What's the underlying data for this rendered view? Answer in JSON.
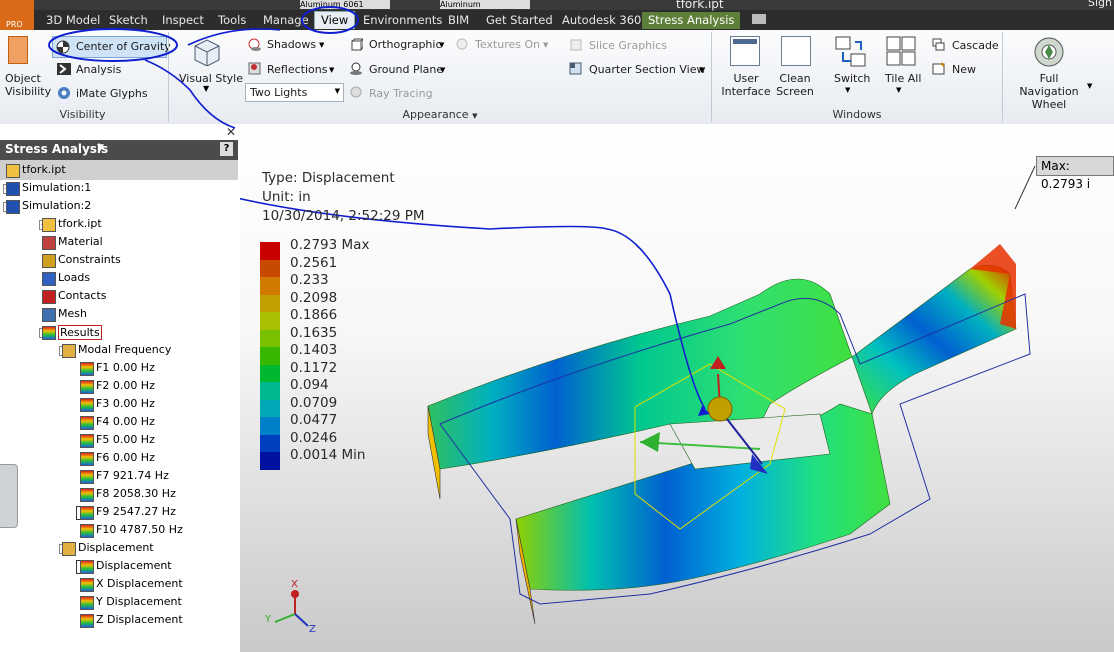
{
  "app": {
    "title": "tfork.ipt",
    "logo_text": "PRO",
    "material": "Aluminum 6061",
    "appearance": "Aluminum",
    "user_short": "Sign"
  },
  "menu": {
    "tabs": [
      "3D Model",
      "Sketch",
      "Inspect",
      "Tools",
      "Manage",
      "View",
      "Environments",
      "BIM",
      "Get Started",
      "Autodesk 360",
      "Stress Analysis"
    ],
    "active": "View"
  },
  "ribbon": {
    "visibility": {
      "object_visibility": "Object Visibility",
      "center_of_gravity": "Center of Gravity",
      "analysis": "Analysis",
      "imate_glyphs": "iMate Glyphs",
      "panel_label": "Visibility"
    },
    "appearance": {
      "visual_style": "Visual Style",
      "shadows": "Shadows",
      "reflections": "Reflections",
      "lighting": "Two Lights",
      "orthographic": "Orthographic",
      "ground_plane": "Ground Plane",
      "ray_tracing": "Ray Tracing",
      "textures_on": "Textures On",
      "slice_graphics": "Slice Graphics",
      "quarter_section_view": "Quarter Section View",
      "panel_label": "Appearance"
    },
    "windows": {
      "user_interface": "User Interface",
      "clean_screen": "Clean Screen",
      "switch": "Switch",
      "tile_all": "Tile All",
      "cascade": "Cascade",
      "new": "New",
      "panel_label": "Windows"
    },
    "navigate": {
      "full_nav_wheel": "Full Navigation Wheel"
    }
  },
  "browser": {
    "title": "Stress Analysis",
    "help": "?",
    "items": [
      {
        "label": "tfork.ipt"
      },
      {
        "label": "Simulation:1"
      },
      {
        "label": "Simulation:2"
      },
      {
        "label": "tfork.ipt"
      },
      {
        "label": "Material"
      },
      {
        "label": "Constraints"
      },
      {
        "label": "Loads"
      },
      {
        "label": "Contacts"
      },
      {
        "label": "Mesh"
      },
      {
        "label": "Results"
      },
      {
        "label": "Modal Frequency"
      },
      {
        "label": "F1  0.00 Hz"
      },
      {
        "label": "F2  0.00 Hz"
      },
      {
        "label": "F3  0.00 Hz"
      },
      {
        "label": "F4  0.00 Hz"
      },
      {
        "label": "F5  0.00 Hz"
      },
      {
        "label": "F6  0.00 Hz"
      },
      {
        "label": "F7  921.74 Hz"
      },
      {
        "label": "F8  2058.30 Hz"
      },
      {
        "label": "F9  2547.27 Hz"
      },
      {
        "label": "F10  4787.50 Hz"
      },
      {
        "label": "Displacement"
      },
      {
        "label": "Displacement"
      },
      {
        "label": "X Displacement"
      },
      {
        "label": "Y Displacement"
      },
      {
        "label": "Z Displacement"
      }
    ]
  },
  "viewport": {
    "type_line": "Type: Displacement",
    "unit_line": "Unit: in",
    "date_line": "10/30/2014, 2:52:29 PM",
    "max_probe": "Max: 0.2793 i",
    "legend": [
      {
        "value": "0.2793 Max",
        "color": "#c80000"
      },
      {
        "value": "0.2561",
        "color": "#c84a00"
      },
      {
        "value": "0.233",
        "color": "#d07a00"
      },
      {
        "value": "0.2098",
        "color": "#c0a000"
      },
      {
        "value": "0.1866",
        "color": "#a8c000"
      },
      {
        "value": "0.1635",
        "color": "#78c000"
      },
      {
        "value": "0.1403",
        "color": "#38b800"
      },
      {
        "value": "0.1172",
        "color": "#00b830"
      },
      {
        "value": "0.094",
        "color": "#00b890"
      },
      {
        "value": "0.0709",
        "color": "#00a8b8"
      },
      {
        "value": "0.0477",
        "color": "#0080c8"
      },
      {
        "value": "0.0246",
        "color": "#0040c0"
      },
      {
        "value": "0.0014 Min",
        "color": "#0010a0"
      }
    ],
    "triad": {
      "x": "X",
      "y": "Y",
      "z": "Z"
    }
  }
}
